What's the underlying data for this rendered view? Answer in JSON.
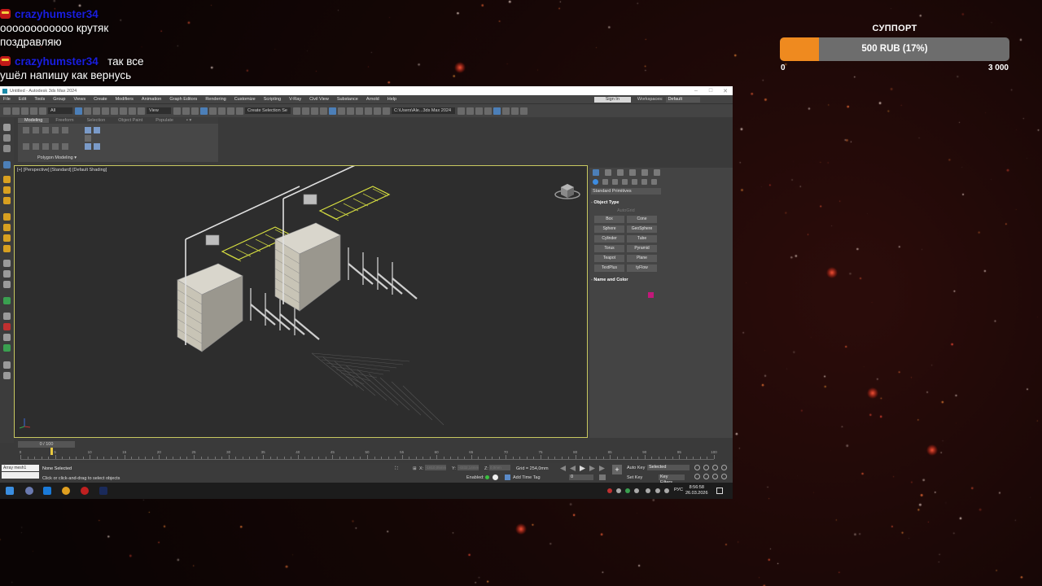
{
  "chat": {
    "messages": [
      {
        "user": "crazyhumster34",
        "lines": [
          "оооооооооооо крутяк",
          "поздравляю"
        ]
      },
      {
        "user": "crazyhumster34",
        "inline": "так все",
        "lines": [
          "ушёл напишу как вернусь"
        ]
      }
    ]
  },
  "support": {
    "title": "СУППОРТ",
    "amount": "500 RUB (17%)",
    "progress_fraction": 0.17,
    "min": "0",
    "max": "3 000",
    "fill_color": "#ef8a1f"
  },
  "app": {
    "title": "Untitled - Autodesk 3ds Max 2024",
    "menu": [
      "File",
      "Edit",
      "Tools",
      "Group",
      "Views",
      "Create",
      "Modifiers",
      "Animation",
      "Graph Editors",
      "Rendering",
      "Customize",
      "Scripting",
      "V-Ray",
      "Civil View",
      "Substance",
      "Arnold",
      "Help"
    ],
    "sign_in": "Sign In",
    "workspaces_label": "Workspaces:",
    "workspace": "Default",
    "toolbar": {
      "selection_filter": "All",
      "view": "View",
      "create_selection_set": "Create Selection Se",
      "project_path": "C:\\Users\\Ale...3ds Max 2024"
    },
    "ribbon": {
      "tabs": [
        "Modeling",
        "Freeform",
        "Selection",
        "Object Paint",
        "Populate"
      ],
      "active_tab": "Modeling",
      "label": "Polygon Modeling"
    },
    "viewport": {
      "label": "[+] [Perspective] [Standard] [Default Shading]"
    },
    "command_panel": {
      "dropdown": "Standard Primitives",
      "object_type_title": "Object Type",
      "autogrid": "AutoGrid",
      "objects": [
        "Box",
        "Cone",
        "Sphere",
        "GeoSphere",
        "Cylinder",
        "Tube",
        "Torus",
        "Pyramid",
        "Teapot",
        "Plane",
        "TextPlus",
        "tyFlow"
      ],
      "name_color_title": "Name and Color",
      "object_color": "#c2187a"
    },
    "timeline": {
      "frame_display": "0 / 100",
      "ticks": [
        "0",
        "5",
        "10",
        "15",
        "20",
        "25",
        "30",
        "35",
        "40",
        "45",
        "50",
        "55",
        "60",
        "65",
        "70",
        "75",
        "80",
        "85",
        "90",
        "95",
        "100"
      ]
    },
    "status": {
      "maxscript": "Array mesh1",
      "selection": "None Selected",
      "prompt": "Click or click-and-drag to select objects",
      "x_label": "X:",
      "x_value": "-1810,05mm",
      "y_label": "Y:",
      "y_value": "-4332,14mm",
      "z_label": "Z:",
      "z_value": "0,0mm",
      "grid": "Grid = 254,0mm",
      "enabled": "Enabled:",
      "add_time_tag": "Add Time Tag",
      "frame": "0",
      "auto_key": "Auto Key",
      "selected": "Selected",
      "set_key": "Set Key",
      "key_filters": "Key Filters..."
    }
  },
  "taskbar": {
    "lang": "РУС",
    "time": "8:56:58",
    "date": "26.03.2026"
  }
}
